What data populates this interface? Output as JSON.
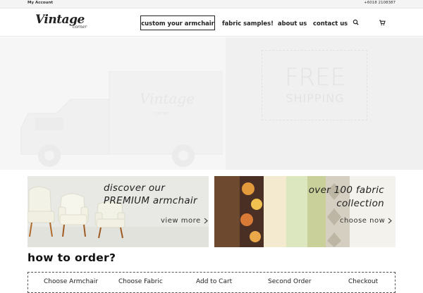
{
  "topbar": {
    "account": "My Account",
    "phone": "+6018 2108387"
  },
  "logo": {
    "script": "Vintage",
    "sub": "corner"
  },
  "nav": {
    "items": [
      {
        "label": "custom your armchair"
      },
      {
        "label": "fabric samples!"
      },
      {
        "label": "about us"
      },
      {
        "label": "contact us"
      }
    ],
    "search_icon": "search-icon",
    "cart_icon": "cart-icon"
  },
  "hero": {
    "truck_logo": "Vintage",
    "truck_sub": "corner",
    "free_top": "",
    "free_big": "FREE",
    "free_ship": "SHIPPING",
    "free_bottom": "",
    "foot": ""
  },
  "banners": [
    {
      "line1": "discover our",
      "line2": "PREMIUM armchair",
      "link": "view more"
    },
    {
      "line1": "over 100 fabric",
      "line2": "collection",
      "link": "choose now"
    }
  ],
  "howto": {
    "title": "how to order?",
    "steps": [
      "Choose Armchair",
      "Choose Fabric",
      "Add to Cart",
      "Second Order",
      "Checkout"
    ]
  },
  "colors": {
    "accent": "#222222",
    "hero_bg": "#f3f3f3",
    "banner1_bg": "#e9e9e6"
  }
}
